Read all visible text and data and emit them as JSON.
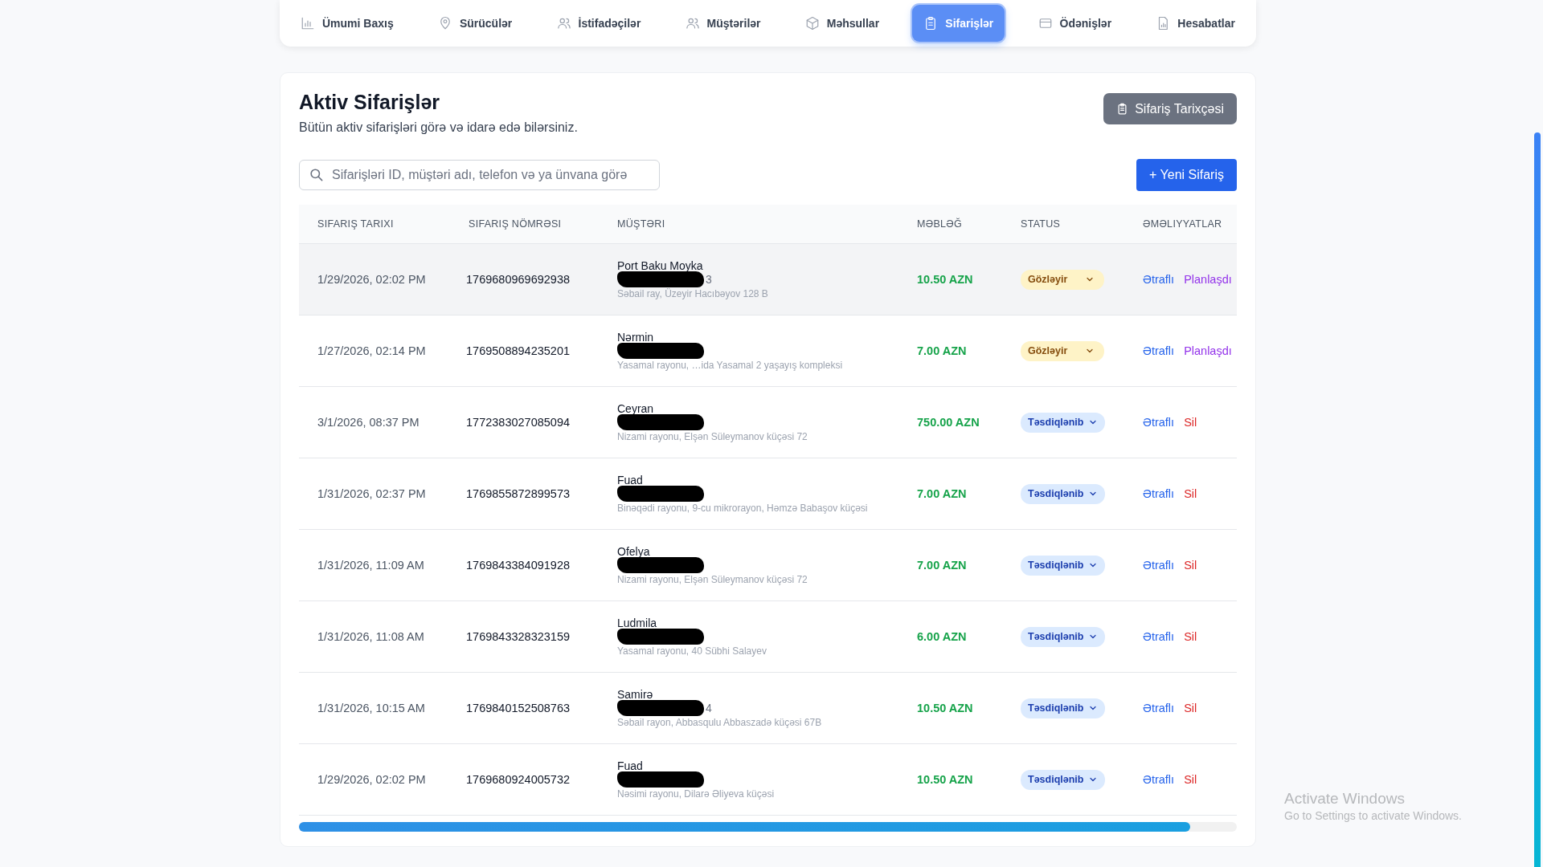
{
  "nav": [
    {
      "label": "Ümumi Baxış",
      "selected": false
    },
    {
      "label": "Sürücülər",
      "selected": false
    },
    {
      "label": "İstifadəçilər",
      "selected": false
    },
    {
      "label": "Müştərilər",
      "selected": false
    },
    {
      "label": "Məhsullar",
      "selected": false
    },
    {
      "label": "Sifarişlər",
      "selected": true
    },
    {
      "label": "Ödənişlər",
      "selected": false
    },
    {
      "label": "Hesabatlar",
      "selected": false
    }
  ],
  "page": {
    "title": "Aktiv Sifarişlər",
    "subtitle": "Bütün aktiv sifarişləri görə və idarə edə bilərsiniz.",
    "history_button": "Sifariş Tarixçəsi",
    "search": {
      "placeholder": "Sifarişləri ID, müştəri adı, telefon və ya ünvana görə"
    },
    "new_button": "+ Yeni Sifariş"
  },
  "table": {
    "columns": [
      "SIFARIŞ TARIXI",
      "SIFARIŞ NÖMRƏSI",
      "MÜŞTƏRI",
      "MƏBLƏĞ",
      "STATUS",
      "ƏMƏLIYYATLAR"
    ],
    "rows": [
      {
        "date": "1/29/2026, 02:02 PM",
        "number": "1769680969692938",
        "customer": "Port Baku Moyka",
        "phone_tail": "3",
        "address": "Səbail ray, Üzeyir Hacıbəyov 128 B",
        "amount": "10.50 AZN",
        "status": {
          "kind": "pending",
          "label": "Gözləyir"
        },
        "actions": [
          {
            "kind": "details",
            "label": "Ətraflı"
          },
          {
            "kind": "schedule",
            "label": "Planlaşdı"
          }
        ],
        "hovered": true
      },
      {
        "date": "1/27/2026, 02:14 PM",
        "number": "1769508894235201",
        "customer": "Nərmin",
        "address": "Yasamal rayonu, …ida Yasamal 2 yaşayış kompleksi",
        "amount": "7.00 AZN",
        "status": {
          "kind": "pending",
          "label": "Gözləyir"
        },
        "actions": [
          {
            "kind": "details",
            "label": "Ətraflı"
          },
          {
            "kind": "schedule",
            "label": "Planlaşdı"
          }
        ],
        "hovered": false
      },
      {
        "date": "3/1/2026, 08:37 PM",
        "number": "1772383027085094",
        "customer": "Ceyran",
        "address": "Nizami rayonu, Elşən Süleymanov küçəsi 72",
        "amount": "750.00 AZN",
        "status": {
          "kind": "confirmed",
          "label": "Təsdiqlənib"
        },
        "actions": [
          {
            "kind": "details",
            "label": "Ətraflı"
          },
          {
            "kind": "delete",
            "label": "Sil"
          }
        ],
        "hovered": false
      },
      {
        "date": "1/31/2026, 02:37 PM",
        "number": "1769855872899573",
        "customer": "Fuad",
        "address": "Binəqədi rayonu, 9-cu mikrorayon, Həmzə Babaşov küçəsi",
        "amount": "7.00 AZN",
        "status": {
          "kind": "confirmed",
          "label": "Təsdiqlənib"
        },
        "actions": [
          {
            "kind": "details",
            "label": "Ətraflı"
          },
          {
            "kind": "delete",
            "label": "Sil"
          }
        ],
        "hovered": false
      },
      {
        "date": "1/31/2026, 11:09 AM",
        "number": "1769843384091928",
        "customer": "Ofelya",
        "address": "Nizami rayonu, Elşən Süleymanov küçəsi 72",
        "amount": "7.00 AZN",
        "status": {
          "kind": "confirmed",
          "label": "Təsdiqlənib"
        },
        "actions": [
          {
            "kind": "details",
            "label": "Ətraflı"
          },
          {
            "kind": "delete",
            "label": "Sil"
          }
        ],
        "hovered": false
      },
      {
        "date": "1/31/2026, 11:08 AM",
        "number": "1769843328323159",
        "customer": "Ludmila",
        "address": "Yasamal rayonu, 40 Sübhi Salayev",
        "amount": "6.00 AZN",
        "status": {
          "kind": "confirmed",
          "label": "Təsdiqlənib"
        },
        "actions": [
          {
            "kind": "details",
            "label": "Ətraflı"
          },
          {
            "kind": "delete",
            "label": "Sil"
          }
        ],
        "hovered": false
      },
      {
        "date": "1/31/2026, 10:15 AM",
        "number": "1769840152508763",
        "customer": "Samirə",
        "phone_tail": "4",
        "address": "Səbail rayon, Abbasqulu Abbaszadə küçəsi 67B",
        "amount": "10.50 AZN",
        "status": {
          "kind": "confirmed",
          "label": "Təsdiqlənib"
        },
        "actions": [
          {
            "kind": "details",
            "label": "Ətraflı"
          },
          {
            "kind": "delete",
            "label": "Sil"
          }
        ],
        "hovered": false
      },
      {
        "date": "1/29/2026, 02:02 PM",
        "number": "1769680924005732",
        "customer": "Fuad",
        "address": "Nəsimi rayonu, Dilarə Əliyeva küçəsi",
        "amount": "10.50 AZN",
        "status": {
          "kind": "confirmed",
          "label": "Təsdiqlənib"
        },
        "actions": [
          {
            "kind": "details",
            "label": "Ətraflı"
          },
          {
            "kind": "delete",
            "label": "Sil"
          }
        ],
        "hovered": false
      }
    ],
    "scroll": {
      "level": 0.95
    }
  },
  "os_notice": {
    "title": "Activate Windows",
    "text": "Go to Settings to activate Windows."
  }
}
